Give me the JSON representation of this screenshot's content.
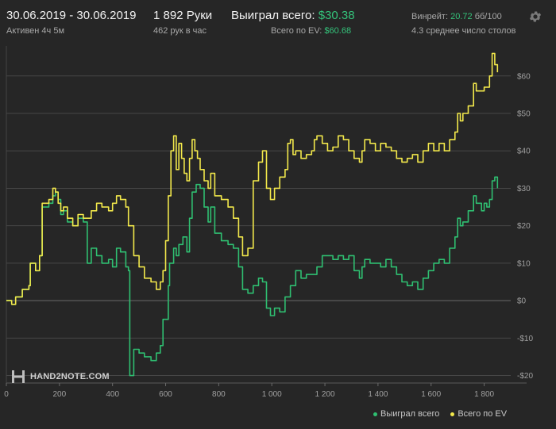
{
  "header": {
    "date_range": "30.06.2019 - 30.06.2019",
    "active": "Активен 4ч 5м",
    "hands": "1 892 Руки",
    "hands_per_hour": "462 рук в час",
    "won_label": "Выиграл всего:",
    "won_value": "$30.38",
    "ev_label": "Всего по EV:",
    "ev_value": "$60.68",
    "winrate_label": "Винрейт:",
    "winrate_value": "20.72",
    "winrate_unit": "бб/100",
    "tables": "4.3 среднее число столов"
  },
  "logo_text": "HAND2NOTE.COM",
  "colors": {
    "won": "#2fbf71",
    "ev": "#f2e84b",
    "background": "#262626",
    "grid": "#4a4a4a"
  },
  "icons": {
    "settings": "gear-icon"
  },
  "chart_data": {
    "type": "line",
    "xlim": [
      0,
      1900
    ],
    "ylim": [
      -22,
      68
    ],
    "x_ticks": [
      0,
      200,
      400,
      600,
      800,
      1000,
      1200,
      1400,
      1600,
      1800
    ],
    "x_tick_labels": [
      "0",
      "200",
      "400",
      "600",
      "800",
      "1 000",
      "1 200",
      "1 400",
      "1 600",
      "1 800"
    ],
    "y_ticks": [
      -20,
      -10,
      0,
      10,
      20,
      30,
      40,
      50,
      60
    ],
    "y_tick_labels": [
      "-$20",
      "-$10",
      "$0",
      "$10",
      "$20",
      "$30",
      "$40",
      "$50",
      "$60"
    ],
    "grid": true,
    "legend_position": "bottom-right",
    "series": [
      {
        "name": "Выиграл всего",
        "color": "#2fbf71",
        "points": [
          [
            0,
            0
          ],
          [
            20,
            -1
          ],
          [
            35,
            1
          ],
          [
            60,
            3
          ],
          [
            85,
            4
          ],
          [
            90,
            10
          ],
          [
            110,
            8
          ],
          [
            125,
            12
          ],
          [
            135,
            25
          ],
          [
            160,
            26
          ],
          [
            175,
            28
          ],
          [
            185,
            29
          ],
          [
            195,
            27
          ],
          [
            205,
            23
          ],
          [
            215,
            24
          ],
          [
            230,
            21
          ],
          [
            250,
            20
          ],
          [
            270,
            22
          ],
          [
            290,
            21
          ],
          [
            305,
            10
          ],
          [
            320,
            14
          ],
          [
            340,
            12
          ],
          [
            360,
            10
          ],
          [
            385,
            11
          ],
          [
            400,
            9
          ],
          [
            415,
            14
          ],
          [
            430,
            13
          ],
          [
            450,
            9
          ],
          [
            460,
            8
          ],
          [
            465,
            -20
          ],
          [
            480,
            -13
          ],
          [
            500,
            -14
          ],
          [
            520,
            -15
          ],
          [
            545,
            -16
          ],
          [
            565,
            -14
          ],
          [
            580,
            -12
          ],
          [
            590,
            -5
          ],
          [
            610,
            4
          ],
          [
            615,
            10
          ],
          [
            630,
            14
          ],
          [
            640,
            12
          ],
          [
            650,
            15
          ],
          [
            665,
            17
          ],
          [
            680,
            13
          ],
          [
            690,
            22
          ],
          [
            700,
            29
          ],
          [
            715,
            31
          ],
          [
            730,
            30
          ],
          [
            745,
            25
          ],
          [
            760,
            21
          ],
          [
            770,
            25
          ],
          [
            785,
            18
          ],
          [
            810,
            16
          ],
          [
            835,
            15
          ],
          [
            855,
            14
          ],
          [
            875,
            9
          ],
          [
            890,
            3
          ],
          [
            910,
            2
          ],
          [
            930,
            4
          ],
          [
            950,
            6
          ],
          [
            965,
            5
          ],
          [
            980,
            -2
          ],
          [
            995,
            -4
          ],
          [
            1010,
            -2
          ],
          [
            1030,
            -3
          ],
          [
            1050,
            1
          ],
          [
            1070,
            4
          ],
          [
            1090,
            8
          ],
          [
            1110,
            6
          ],
          [
            1130,
            7
          ],
          [
            1150,
            7
          ],
          [
            1170,
            9
          ],
          [
            1190,
            12
          ],
          [
            1210,
            12
          ],
          [
            1230,
            11
          ],
          [
            1250,
            12
          ],
          [
            1270,
            11
          ],
          [
            1290,
            12
          ],
          [
            1310,
            8
          ],
          [
            1330,
            6
          ],
          [
            1340,
            9
          ],
          [
            1350,
            11
          ],
          [
            1370,
            10
          ],
          [
            1390,
            10
          ],
          [
            1410,
            9
          ],
          [
            1430,
            11
          ],
          [
            1450,
            9
          ],
          [
            1470,
            7
          ],
          [
            1490,
            5
          ],
          [
            1510,
            4
          ],
          [
            1530,
            5
          ],
          [
            1550,
            3
          ],
          [
            1570,
            6
          ],
          [
            1590,
            8
          ],
          [
            1610,
            10
          ],
          [
            1630,
            11
          ],
          [
            1650,
            10
          ],
          [
            1670,
            14
          ],
          [
            1690,
            17
          ],
          [
            1700,
            22
          ],
          [
            1710,
            20
          ],
          [
            1720,
            21
          ],
          [
            1740,
            24
          ],
          [
            1760,
            28
          ],
          [
            1770,
            26
          ],
          [
            1790,
            24
          ],
          [
            1800,
            26
          ],
          [
            1810,
            25
          ],
          [
            1820,
            27
          ],
          [
            1830,
            32
          ],
          [
            1840,
            33
          ],
          [
            1850,
            30
          ]
        ]
      },
      {
        "name": "Всего по EV",
        "color": "#f2e84b",
        "points": [
          [
            0,
            0
          ],
          [
            20,
            -1
          ],
          [
            35,
            1
          ],
          [
            60,
            3
          ],
          [
            85,
            4
          ],
          [
            90,
            10
          ],
          [
            110,
            8
          ],
          [
            125,
            12
          ],
          [
            135,
            26
          ],
          [
            160,
            27
          ],
          [
            175,
            30
          ],
          [
            185,
            29
          ],
          [
            195,
            26
          ],
          [
            205,
            24
          ],
          [
            215,
            25
          ],
          [
            230,
            22
          ],
          [
            250,
            20
          ],
          [
            270,
            23
          ],
          [
            290,
            22
          ],
          [
            305,
            22
          ],
          [
            320,
            24
          ],
          [
            340,
            26
          ],
          [
            360,
            25
          ],
          [
            385,
            24
          ],
          [
            400,
            26
          ],
          [
            415,
            28
          ],
          [
            430,
            27
          ],
          [
            450,
            25
          ],
          [
            460,
            20
          ],
          [
            480,
            12
          ],
          [
            500,
            9
          ],
          [
            520,
            6
          ],
          [
            545,
            5
          ],
          [
            565,
            3
          ],
          [
            580,
            5
          ],
          [
            590,
            8
          ],
          [
            600,
            16
          ],
          [
            610,
            28
          ],
          [
            620,
            40
          ],
          [
            630,
            44
          ],
          [
            640,
            35
          ],
          [
            650,
            42
          ],
          [
            660,
            38
          ],
          [
            670,
            34
          ],
          [
            680,
            32
          ],
          [
            690,
            38
          ],
          [
            700,
            43
          ],
          [
            710,
            40
          ],
          [
            720,
            38
          ],
          [
            730,
            35
          ],
          [
            745,
            32
          ],
          [
            760,
            30
          ],
          [
            770,
            34
          ],
          [
            785,
            28
          ],
          [
            810,
            27
          ],
          [
            835,
            25
          ],
          [
            855,
            22
          ],
          [
            875,
            17
          ],
          [
            890,
            12
          ],
          [
            910,
            14
          ],
          [
            930,
            32
          ],
          [
            950,
            37
          ],
          [
            965,
            40
          ],
          [
            980,
            30
          ],
          [
            995,
            27
          ],
          [
            1010,
            30
          ],
          [
            1030,
            33
          ],
          [
            1050,
            35
          ],
          [
            1060,
            42
          ],
          [
            1070,
            43
          ],
          [
            1080,
            39
          ],
          [
            1090,
            40
          ],
          [
            1110,
            38
          ],
          [
            1130,
            39
          ],
          [
            1150,
            40
          ],
          [
            1160,
            43
          ],
          [
            1170,
            44
          ],
          [
            1190,
            42
          ],
          [
            1210,
            40
          ],
          [
            1230,
            41
          ],
          [
            1250,
            44
          ],
          [
            1270,
            43
          ],
          [
            1290,
            40
          ],
          [
            1310,
            38
          ],
          [
            1330,
            37
          ],
          [
            1340,
            40
          ],
          [
            1350,
            43
          ],
          [
            1370,
            42
          ],
          [
            1390,
            40
          ],
          [
            1410,
            42
          ],
          [
            1430,
            41
          ],
          [
            1450,
            40
          ],
          [
            1470,
            38
          ],
          [
            1490,
            37
          ],
          [
            1510,
            38
          ],
          [
            1530,
            39
          ],
          [
            1550,
            37
          ],
          [
            1570,
            40
          ],
          [
            1590,
            42
          ],
          [
            1610,
            40
          ],
          [
            1630,
            42
          ],
          [
            1650,
            40
          ],
          [
            1670,
            43
          ],
          [
            1690,
            45
          ],
          [
            1700,
            50
          ],
          [
            1710,
            48
          ],
          [
            1720,
            50
          ],
          [
            1740,
            52
          ],
          [
            1760,
            58
          ],
          [
            1770,
            56
          ],
          [
            1790,
            56
          ],
          [
            1800,
            57
          ],
          [
            1810,
            57
          ],
          [
            1820,
            60
          ],
          [
            1830,
            66
          ],
          [
            1840,
            63
          ],
          [
            1850,
            61
          ]
        ]
      }
    ]
  }
}
